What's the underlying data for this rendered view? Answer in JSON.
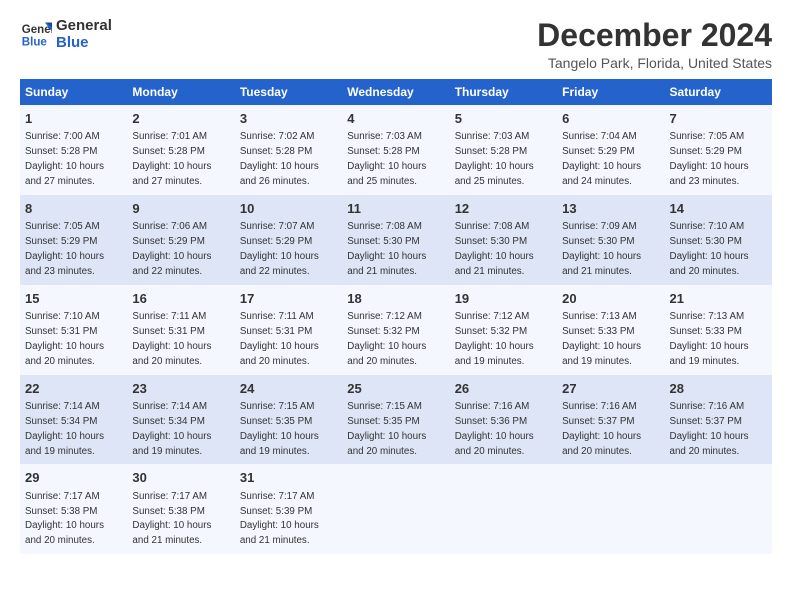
{
  "logo": {
    "general": "General",
    "blue": "Blue"
  },
  "title": "December 2024",
  "subtitle": "Tangelo Park, Florida, United States",
  "headers": [
    "Sunday",
    "Monday",
    "Tuesday",
    "Wednesday",
    "Thursday",
    "Friday",
    "Saturday"
  ],
  "weeks": [
    [
      {
        "day": "1",
        "info": "Sunrise: 7:00 AM\nSunset: 5:28 PM\nDaylight: 10 hours\nand 27 minutes."
      },
      {
        "day": "2",
        "info": "Sunrise: 7:01 AM\nSunset: 5:28 PM\nDaylight: 10 hours\nand 27 minutes."
      },
      {
        "day": "3",
        "info": "Sunrise: 7:02 AM\nSunset: 5:28 PM\nDaylight: 10 hours\nand 26 minutes."
      },
      {
        "day": "4",
        "info": "Sunrise: 7:03 AM\nSunset: 5:28 PM\nDaylight: 10 hours\nand 25 minutes."
      },
      {
        "day": "5",
        "info": "Sunrise: 7:03 AM\nSunset: 5:28 PM\nDaylight: 10 hours\nand 25 minutes."
      },
      {
        "day": "6",
        "info": "Sunrise: 7:04 AM\nSunset: 5:29 PM\nDaylight: 10 hours\nand 24 minutes."
      },
      {
        "day": "7",
        "info": "Sunrise: 7:05 AM\nSunset: 5:29 PM\nDaylight: 10 hours\nand 23 minutes."
      }
    ],
    [
      {
        "day": "8",
        "info": "Sunrise: 7:05 AM\nSunset: 5:29 PM\nDaylight: 10 hours\nand 23 minutes."
      },
      {
        "day": "9",
        "info": "Sunrise: 7:06 AM\nSunset: 5:29 PM\nDaylight: 10 hours\nand 22 minutes."
      },
      {
        "day": "10",
        "info": "Sunrise: 7:07 AM\nSunset: 5:29 PM\nDaylight: 10 hours\nand 22 minutes."
      },
      {
        "day": "11",
        "info": "Sunrise: 7:08 AM\nSunset: 5:30 PM\nDaylight: 10 hours\nand 21 minutes."
      },
      {
        "day": "12",
        "info": "Sunrise: 7:08 AM\nSunset: 5:30 PM\nDaylight: 10 hours\nand 21 minutes."
      },
      {
        "day": "13",
        "info": "Sunrise: 7:09 AM\nSunset: 5:30 PM\nDaylight: 10 hours\nand 21 minutes."
      },
      {
        "day": "14",
        "info": "Sunrise: 7:10 AM\nSunset: 5:30 PM\nDaylight: 10 hours\nand 20 minutes."
      }
    ],
    [
      {
        "day": "15",
        "info": "Sunrise: 7:10 AM\nSunset: 5:31 PM\nDaylight: 10 hours\nand 20 minutes."
      },
      {
        "day": "16",
        "info": "Sunrise: 7:11 AM\nSunset: 5:31 PM\nDaylight: 10 hours\nand 20 minutes."
      },
      {
        "day": "17",
        "info": "Sunrise: 7:11 AM\nSunset: 5:31 PM\nDaylight: 10 hours\nand 20 minutes."
      },
      {
        "day": "18",
        "info": "Sunrise: 7:12 AM\nSunset: 5:32 PM\nDaylight: 10 hours\nand 20 minutes."
      },
      {
        "day": "19",
        "info": "Sunrise: 7:12 AM\nSunset: 5:32 PM\nDaylight: 10 hours\nand 19 minutes."
      },
      {
        "day": "20",
        "info": "Sunrise: 7:13 AM\nSunset: 5:33 PM\nDaylight: 10 hours\nand 19 minutes."
      },
      {
        "day": "21",
        "info": "Sunrise: 7:13 AM\nSunset: 5:33 PM\nDaylight: 10 hours\nand 19 minutes."
      }
    ],
    [
      {
        "day": "22",
        "info": "Sunrise: 7:14 AM\nSunset: 5:34 PM\nDaylight: 10 hours\nand 19 minutes."
      },
      {
        "day": "23",
        "info": "Sunrise: 7:14 AM\nSunset: 5:34 PM\nDaylight: 10 hours\nand 19 minutes."
      },
      {
        "day": "24",
        "info": "Sunrise: 7:15 AM\nSunset: 5:35 PM\nDaylight: 10 hours\nand 19 minutes."
      },
      {
        "day": "25",
        "info": "Sunrise: 7:15 AM\nSunset: 5:35 PM\nDaylight: 10 hours\nand 20 minutes."
      },
      {
        "day": "26",
        "info": "Sunrise: 7:16 AM\nSunset: 5:36 PM\nDaylight: 10 hours\nand 20 minutes."
      },
      {
        "day": "27",
        "info": "Sunrise: 7:16 AM\nSunset: 5:37 PM\nDaylight: 10 hours\nand 20 minutes."
      },
      {
        "day": "28",
        "info": "Sunrise: 7:16 AM\nSunset: 5:37 PM\nDaylight: 10 hours\nand 20 minutes."
      }
    ],
    [
      {
        "day": "29",
        "info": "Sunrise: 7:17 AM\nSunset: 5:38 PM\nDaylight: 10 hours\nand 20 minutes."
      },
      {
        "day": "30",
        "info": "Sunrise: 7:17 AM\nSunset: 5:38 PM\nDaylight: 10 hours\nand 21 minutes."
      },
      {
        "day": "31",
        "info": "Sunrise: 7:17 AM\nSunset: 5:39 PM\nDaylight: 10 hours\nand 21 minutes."
      },
      null,
      null,
      null,
      null
    ]
  ]
}
